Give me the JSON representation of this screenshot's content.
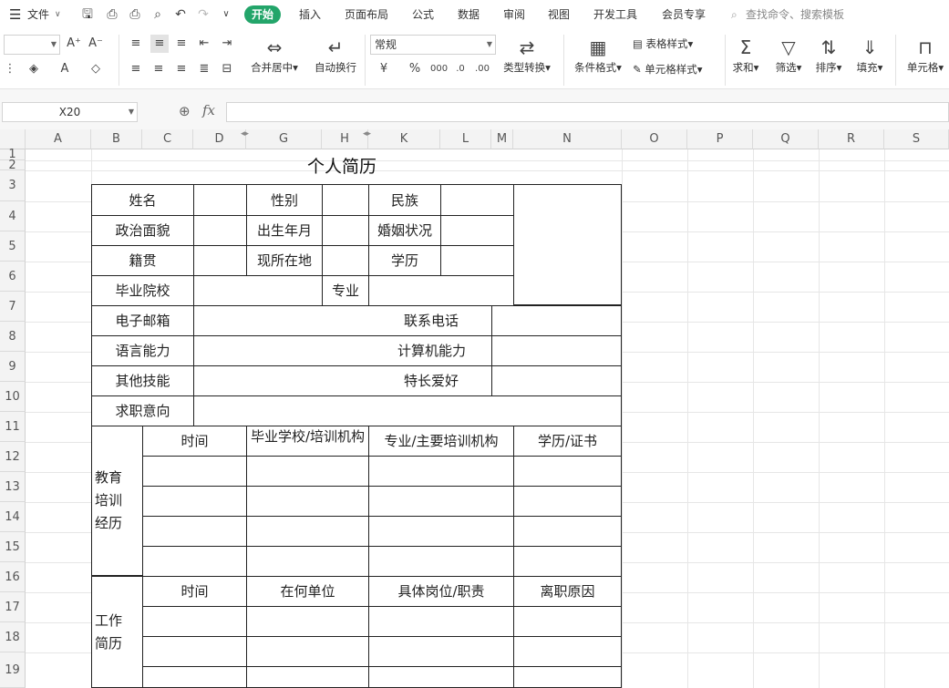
{
  "menu": {
    "file_label": "文件",
    "tabs": [
      "开始",
      "插入",
      "页面布局",
      "公式",
      "数据",
      "审阅",
      "视图",
      "开发工具",
      "会员专享"
    ],
    "search_placeholder": "查找命令、搜索模板"
  },
  "ribbon": {
    "merge_center": "合并居中",
    "auto_wrap": "自动换行",
    "number_format": "常规",
    "type_convert": "类型转换",
    "conditional_format": "条件格式",
    "table_style": "表格样式",
    "cell_style": "单元格样式",
    "sum": "求和",
    "filter": "筛选",
    "sort": "排序",
    "fill": "填充",
    "cells": "单元格"
  },
  "formula_bar": {
    "name_box": "X20",
    "fx": "fx"
  },
  "columns": [
    "A",
    "B",
    "C",
    "D",
    "G",
    "H",
    "K",
    "L",
    "M",
    "N",
    "O",
    "P",
    "Q",
    "R",
    "S"
  ],
  "rows": [
    "1",
    "2",
    "3",
    "4",
    "5",
    "6",
    "7",
    "8",
    "9",
    "10",
    "11",
    "12",
    "13",
    "14",
    "15",
    "16",
    "17",
    "18",
    "19"
  ],
  "sheet": {
    "title": "个人简历",
    "name": "姓名",
    "gender": "性别",
    "ethnicity": "民族",
    "political_status": "政治面貌",
    "birth_date": "出生年月",
    "marital_status": "婚姻状况",
    "native_place": "籍贯",
    "current_location": "现所在地",
    "education": "学历",
    "school": "毕业院校",
    "major": "专业",
    "email": "电子邮箱",
    "phone": "联系电话",
    "language": "语言能力",
    "computer": "计算机能力",
    "other_skills": "其他技能",
    "hobbies": "特长爱好",
    "job_intention": "求职意向",
    "edu_section": [
      "教育",
      "培训",
      "经历"
    ],
    "edu_headers": [
      "时间",
      "毕业学校/培训机构",
      "专业/主要培训机构",
      "学历/证书"
    ],
    "work_section": [
      "工作",
      "简历"
    ],
    "work_headers": [
      "时间",
      "在何单位",
      "具体岗位/职责",
      "离职原因"
    ]
  }
}
